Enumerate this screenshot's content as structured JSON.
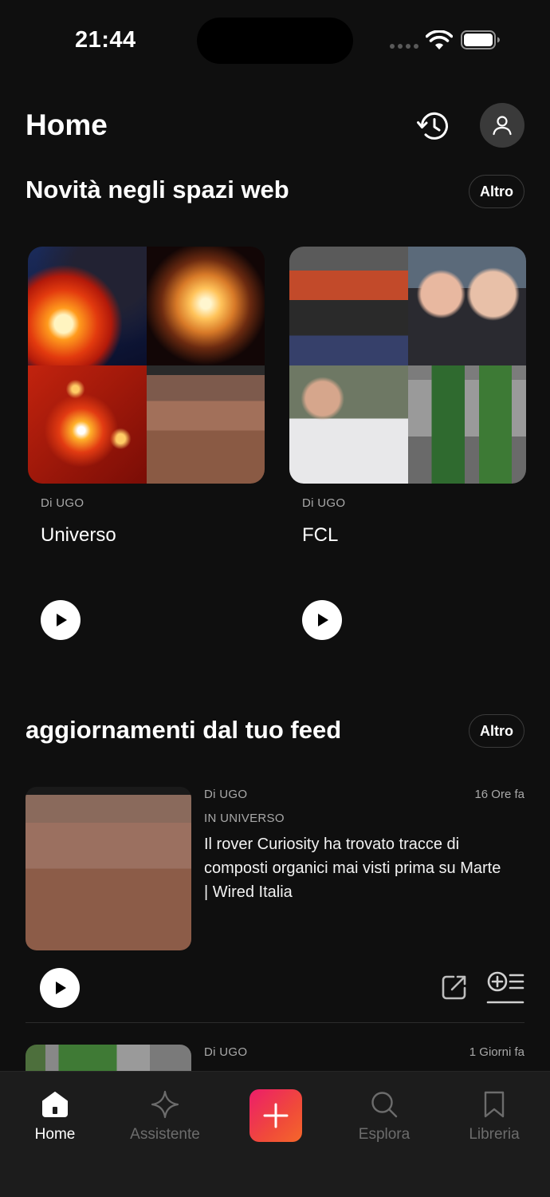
{
  "status_bar": {
    "time": "21:44"
  },
  "header": {
    "title": "Home"
  },
  "spaces_section": {
    "title": "Novità negli spazi web",
    "more_label": "Altro",
    "cards": [
      {
        "author": "Di UGO",
        "title": "Universo"
      },
      {
        "author": "Di UGO",
        "title": "FCL"
      }
    ]
  },
  "feed_section": {
    "title": "aggiornamenti dal tuo feed",
    "more_label": "Altro",
    "items": [
      {
        "author": "Di UGO",
        "time": "16 Ore fa",
        "space": "IN UNIVERSO",
        "headline": "Il rover Curiosity ha trovato tracce di composti organici mai visti prima su Marte | Wired Italia"
      },
      {
        "author": "Di UGO",
        "time": "1 Giorni fa"
      }
    ]
  },
  "bottom_nav": {
    "items": [
      {
        "label": "Home",
        "icon": "home-icon",
        "active": true
      },
      {
        "label": "Assistente",
        "icon": "sparkle-icon",
        "active": false
      },
      {
        "label": "",
        "icon": "plus-icon",
        "active": false
      },
      {
        "label": "Esplora",
        "icon": "search-icon",
        "active": false
      },
      {
        "label": "Libreria",
        "icon": "bookmark-icon",
        "active": false
      }
    ]
  },
  "colors": {
    "background": "#0f0f0f",
    "accent_start": "#ec1d6a",
    "accent_end": "#f5672a"
  }
}
